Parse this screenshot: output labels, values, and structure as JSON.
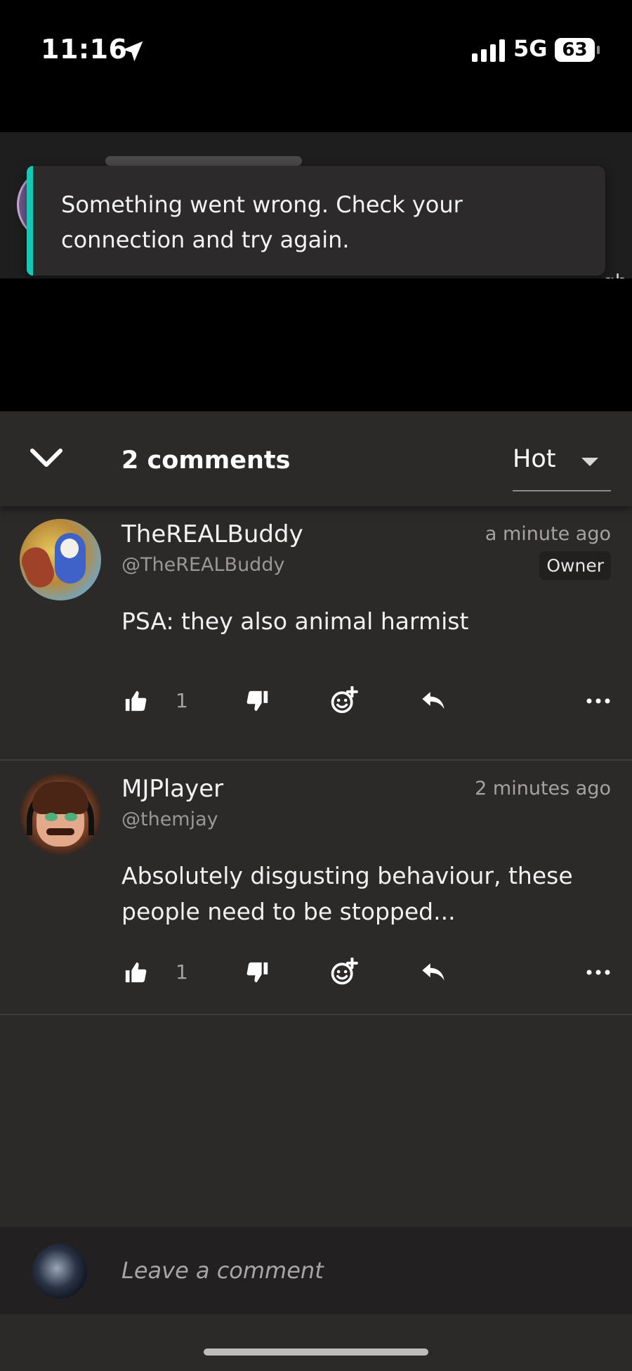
{
  "status_bar": {
    "time": "11:16",
    "network": "5G",
    "battery": "63",
    "icons": [
      "location-arrow-icon",
      "signal-bars-icon",
      "battery-icon"
    ]
  },
  "toast": {
    "message": "Something went wrong. Check your connection and try again.",
    "accent_color": "#13c9b6"
  },
  "background_post": {
    "trailing_text": "gh"
  },
  "comments_header": {
    "count_label": "2 comments",
    "sort_value": "Hot",
    "icons": [
      "chevron-down-icon",
      "caret-down-icon"
    ]
  },
  "comments": [
    {
      "username": "TheREALBuddy",
      "handle": "@TheREALBuddy",
      "timestamp": "a minute ago",
      "badge": "Owner",
      "text": "PSA: they also animal harmist",
      "likes": "1"
    },
    {
      "username": "MJPlayer",
      "handle": "@themjay",
      "timestamp": "2 minutes ago",
      "text": "Absolutely disgusting behaviour, these people need to be stopped...",
      "likes": "1"
    }
  ],
  "action_icons": [
    "thumbs-up-icon",
    "thumbs-down-icon",
    "add-reaction-icon",
    "reply-icon",
    "more-options-icon"
  ],
  "composer": {
    "placeholder": "Leave a comment"
  },
  "colors": {
    "sheet_background": "#2c2929",
    "toast_background": "#2c2a2a",
    "composer_background": "#222020"
  }
}
